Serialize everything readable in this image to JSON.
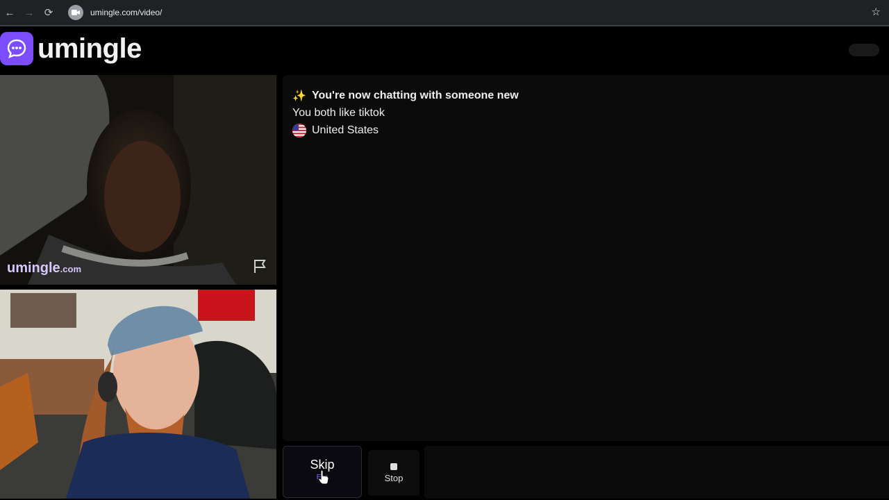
{
  "browser": {
    "url": "umingle.com/video/",
    "back_icon": "←",
    "forward_icon": "→",
    "reload_icon": "⟳",
    "bookmark_icon": "☆"
  },
  "header": {
    "logo_text": "umingle",
    "logo_color": "#7c4dff"
  },
  "video_top": {
    "watermark_main": "umingle",
    "watermark_suffix": ".com"
  },
  "chat": {
    "messages": [
      {
        "icon": "✨",
        "text": "You're now chatting with someone new"
      },
      {
        "text": "You both like tiktok"
      },
      {
        "icon": "us-flag",
        "text": "United States"
      }
    ]
  },
  "controls": {
    "skip_label": "Skip",
    "skip_hint": "Esc",
    "stop_label": "Stop"
  }
}
